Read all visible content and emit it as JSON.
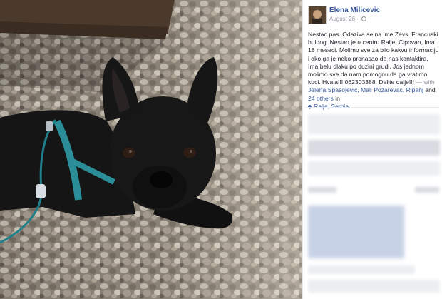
{
  "post": {
    "author": "Elena Milicevic",
    "date": "August 26 ·",
    "text": "Nestao pas. Odaziva se na ime Zevs. Francuski buldog. Nestao je u centru Ralje. Cipovan, Ima 18 meseci. Molimo sve za bilo kakvu informaciju i ako ga je neko pronasao da nas kontaktira. Ima belu dlaku po duzini grudi. Jos jednom molimo sve da nam pomognu da ga vratimo kuci. Hvala!!! 062303388. Delite dalje!!!",
    "with_prefix": " — with ",
    "tagged": "Jelena Spasojević, Mali Požarevac, Ripanj",
    "and_text": " and ",
    "others": "24 others",
    "in_text": " in",
    "location": "Ralja, Serbia."
  },
  "photo": {
    "subject": "black French bulldog with teal harness on gravel",
    "colors": {
      "dog": "#141414",
      "harness": "#2a8d97",
      "gravel": "#8c8378",
      "wood": "#4b3a2c"
    }
  },
  "icons": {
    "privacy": "globe-icon",
    "location": "map-pin-icon"
  },
  "colors": {
    "link": "#365899",
    "text": "#1d2129",
    "meta": "#90949c"
  }
}
